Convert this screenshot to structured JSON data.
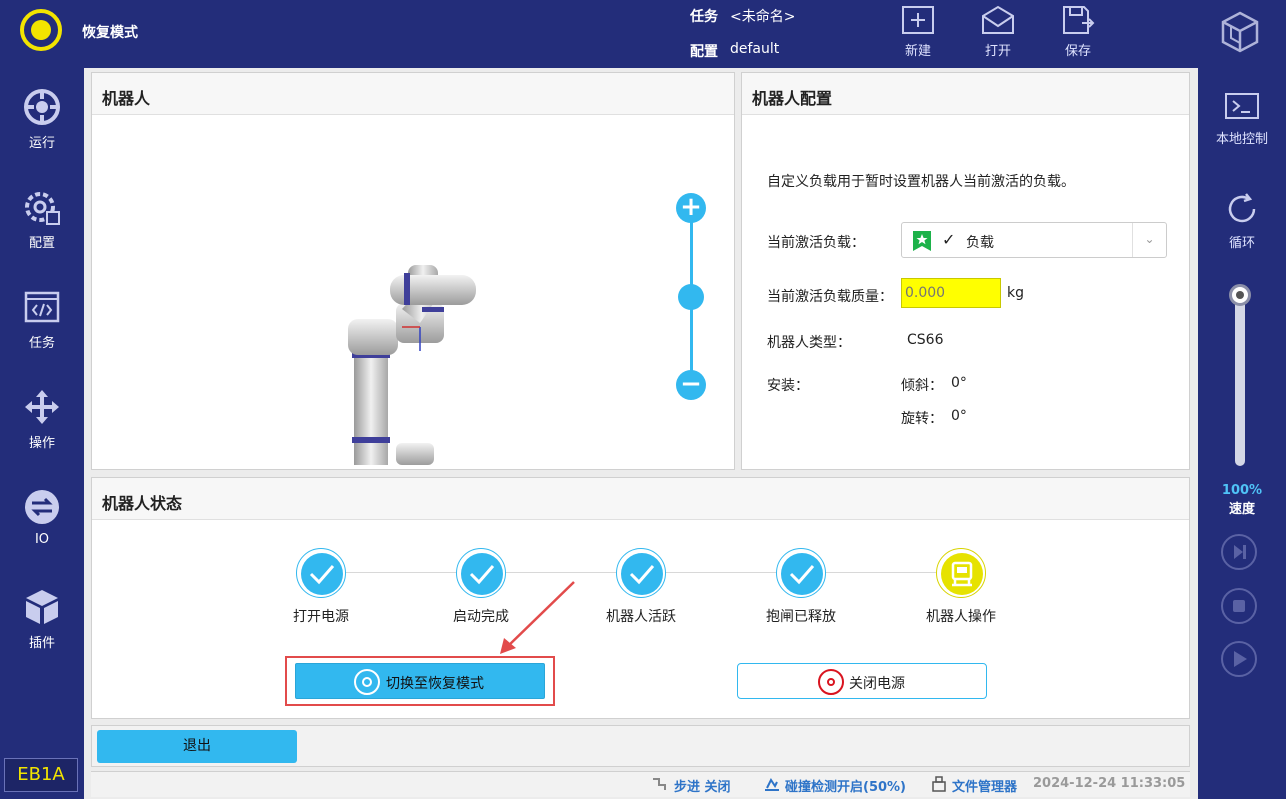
{
  "header": {
    "mode_title": "恢复模式",
    "task_label": "任务",
    "task_value": "<未命名>",
    "config_label": "配置",
    "config_value": "default",
    "buttons": {
      "new": "新建",
      "open": "打开",
      "save": "保存"
    }
  },
  "left_nav": {
    "items": [
      "运行",
      "配置",
      "任务",
      "操作",
      "IO",
      "插件"
    ],
    "version_badge": "EB1A"
  },
  "right_nav": {
    "local_control": "本地控制",
    "loop": "循环",
    "speed_percent": "100%",
    "speed_label": "速度",
    "speed_value": 100
  },
  "robot_panel": {
    "title": "机器人"
  },
  "config_panel": {
    "title": "机器人配置",
    "description": "自定义负载用于暂时设置机器人当前激活的负载。",
    "active_payload_label": "当前激活负载：",
    "active_payload_value": "负载",
    "payload_mass_label": "当前激活负载质量：",
    "payload_mass_placeholder": "0.000",
    "payload_mass_unit": "kg",
    "robot_type_label": "机器人类型：",
    "robot_type_value": "CS66",
    "mount_label": "安装：",
    "tilt_label": "倾斜：",
    "tilt_value": "0°",
    "rotation_label": "旋转：",
    "rotation_value": "0°"
  },
  "status_panel": {
    "title": "机器人状态",
    "steps": [
      "打开电源",
      "启动完成",
      "机器人活跃",
      "抱闸已释放",
      "机器人操作"
    ],
    "recover_button": "切换至恢复模式",
    "power_off_button": "关闭电源"
  },
  "exit_button": "退出",
  "status_bar": {
    "step": "步进 关闭",
    "collision": "碰撞检测开启(50%)",
    "file_manager": "文件管理器",
    "timestamp": "2024-12-24 11:33:05"
  },
  "colors": {
    "brand_navy": "#232d7a",
    "accent_blue": "#32b8ef",
    "accent_yellow": "#f2e400",
    "highlight_red": "#e24b4b"
  }
}
